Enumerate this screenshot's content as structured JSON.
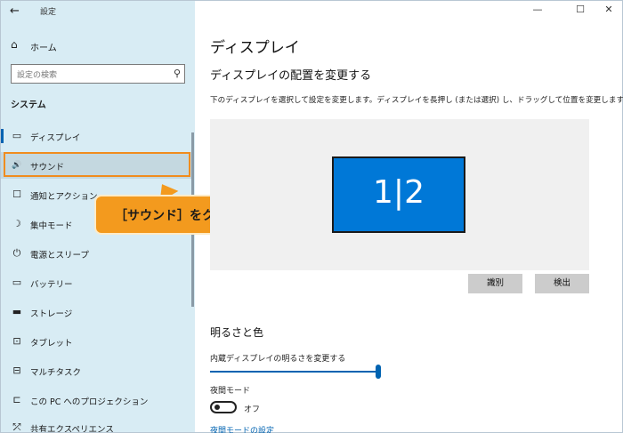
{
  "titlebar": {
    "back": "←",
    "app_title": "設定",
    "minimize": "—",
    "maximize": "☐",
    "close": "✕"
  },
  "sidebar": {
    "home": {
      "label": "ホーム",
      "icon": "⌂"
    },
    "search_placeholder": "設定の検索",
    "search_icon": "⚲",
    "section": "システム",
    "items": [
      {
        "label": "ディスプレイ",
        "icon": "▭",
        "active": true
      },
      {
        "label": "サウンド",
        "icon": "🔊"
      },
      {
        "label": "通知とアクション",
        "icon": "☐"
      },
      {
        "label": "集中モード",
        "icon": "☽"
      },
      {
        "label": "電源とスリープ",
        "icon": "⏻"
      },
      {
        "label": "バッテリー",
        "icon": "▭"
      },
      {
        "label": "ストレージ",
        "icon": "▬"
      },
      {
        "label": "タブレット",
        "icon": "⊡"
      },
      {
        "label": "マルチタスク",
        "icon": "⊟"
      },
      {
        "label": "この PC へのプロジェクション",
        "icon": "⊏"
      },
      {
        "label": "共有エクスペリエンス",
        "icon": "⤱"
      }
    ]
  },
  "callout": {
    "text": "［サウンド］をクリック"
  },
  "main": {
    "page_title": "ディスプレイ",
    "sub_title": "ディスプレイの配置を変更する",
    "description": "下のディスプレイを選択して設定を変更します。ディスプレイを長押し (または選択) し、ドラッグして位置を変更します。",
    "monitor_label": "1|2",
    "identify_button": "識別",
    "detect_button": "検出",
    "brightness_section": "明るさと色",
    "brightness_label": "内蔵ディスプレイの明るさを変更する",
    "brightness_level_percent": 100,
    "night_mode_label": "夜間モード",
    "night_mode_state": "オフ",
    "night_mode_link": "夜間モードの設定"
  },
  "colors": {
    "sidebar_bg": "#d8ecf4",
    "accent": "#0063b1",
    "monitor": "#0078d7",
    "callout": "#f39a1e"
  }
}
